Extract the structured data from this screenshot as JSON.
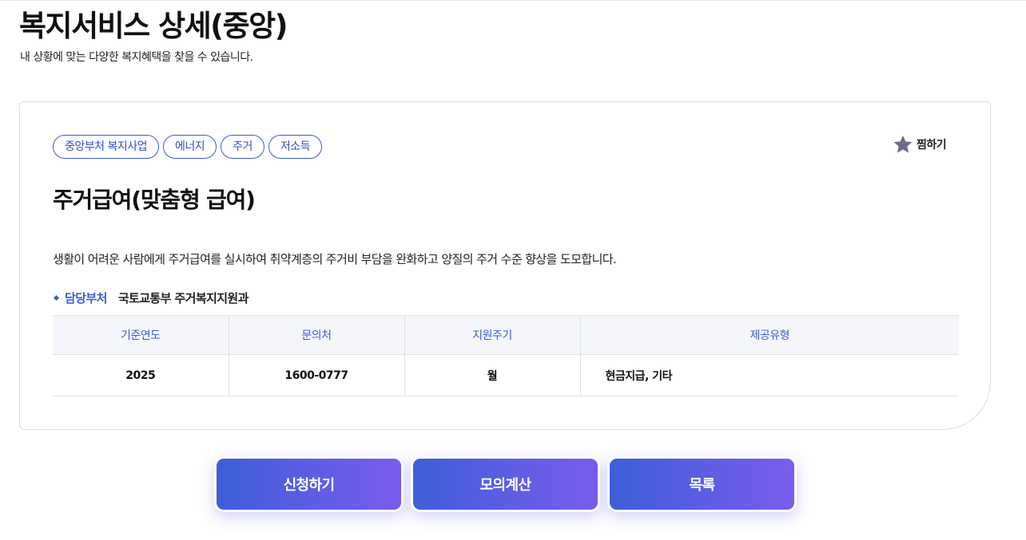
{
  "header": {
    "title": "복지서비스 상세(중앙)",
    "subtitle": "내 상황에 맞는 다양한 복지혜택을 찾을 수 있습니다."
  },
  "service": {
    "tags": [
      "중앙부처 복지사업",
      "에너지",
      "주거",
      "저소득"
    ],
    "bookmark_label": "찜하기",
    "bookmark_icon": "star-icon",
    "title": "주거급여(맞춤형 급여)",
    "description": "생활이 어려운 사람에게 주거급여를 실시하여 취약계층의 주거비 부담을 완화하고 양질의 주거 수준 향상을 도모합니다.",
    "department_label": "담당부처",
    "department": "국토교통부 주거복지지원과"
  },
  "info_table": {
    "headers": [
      "기준연도",
      "문의처",
      "지원주기",
      "제공유형"
    ],
    "row": [
      "2025",
      "1600-0777",
      "월",
      "현금지급, 기타"
    ]
  },
  "actions": {
    "apply_label": "신청하기",
    "simulate_label": "모의계산",
    "list_label": "목록"
  },
  "colors": {
    "accent": "#3d5bd6",
    "button_gradient_start": "#3d5fd8",
    "button_gradient_end": "#7a5cee",
    "star": "#6b6d85"
  }
}
